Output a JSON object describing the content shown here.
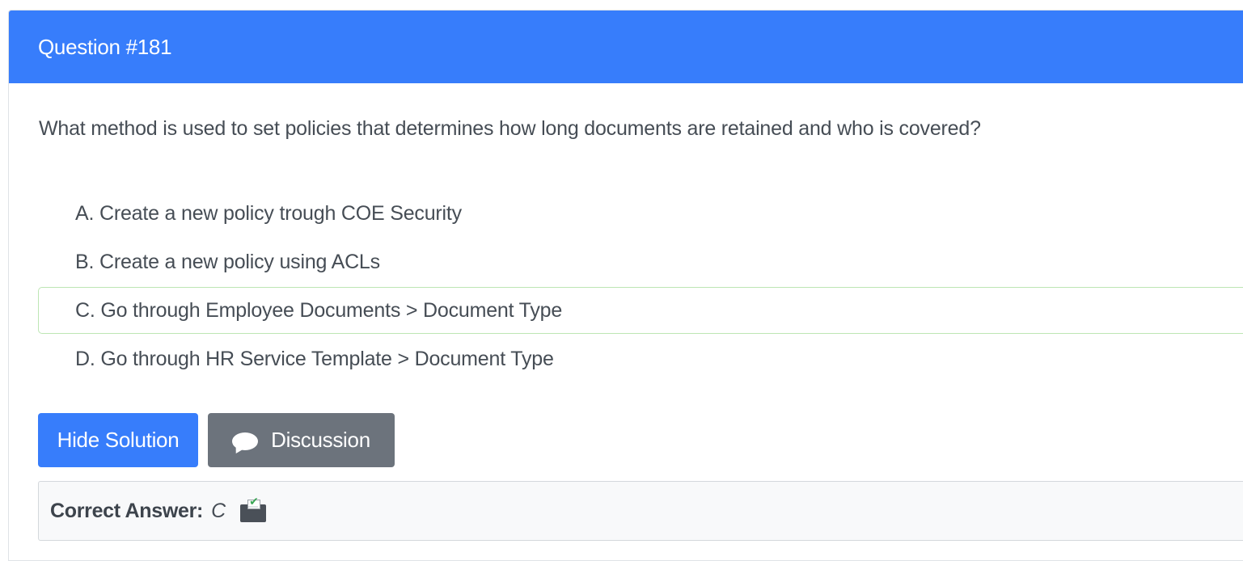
{
  "header": {
    "title": "Question #181"
  },
  "question": {
    "text": "What method is used to set policies that determines how long documents are retained and who is covered?"
  },
  "choices": [
    {
      "label": "A. Create a new policy trough COE Security",
      "correct": false
    },
    {
      "label": "B. Create a new policy using ACLs",
      "correct": false
    },
    {
      "label": "C. Go through Employee Documents > Document Type",
      "correct": true
    },
    {
      "label": "D. Go through HR Service Template > Document Type",
      "correct": false
    }
  ],
  "buttons": {
    "hide_solution": "Hide Solution",
    "discussion": "Discussion"
  },
  "answer": {
    "label": "Correct Answer:",
    "value": "C",
    "icon": "vote-box-icon"
  },
  "colors": {
    "accent": "#377dfb",
    "secondary": "#6c737c",
    "correct_border": "#bde6b4"
  }
}
